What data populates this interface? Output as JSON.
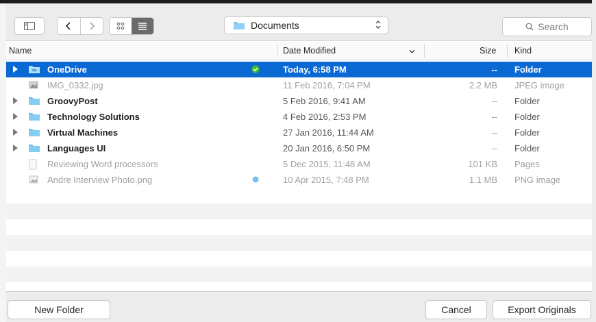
{
  "toolbar": {
    "location": "Documents",
    "search_placeholder": "Search"
  },
  "columns": {
    "name": "Name",
    "date": "Date Modified",
    "size": "Size",
    "kind": "Kind"
  },
  "files": [
    {
      "name": "OneDrive",
      "date": "Today, 6:58 PM",
      "size": "--",
      "kind": "Folder",
      "icon": "folder-cloud-icon",
      "badge": "green-check"
    },
    {
      "name": "IMG_0332.jpg",
      "date": "11 Feb 2016, 7:04 PM",
      "size": "2.2 MB",
      "kind": "JPEG image",
      "icon": "image-file-icon"
    },
    {
      "name": "GroovyPost",
      "date": "5 Feb 2016, 9:41 AM",
      "size": "--",
      "kind": "Folder",
      "icon": "folder-icon"
    },
    {
      "name": "Technology Solutions",
      "date": "4 Feb 2016, 2:53 PM",
      "size": "--",
      "kind": "Folder",
      "icon": "folder-icon"
    },
    {
      "name": "Virtual Machines",
      "date": "27 Jan 2016, 11:44 AM",
      "size": "--",
      "kind": "Folder",
      "icon": "folder-icon"
    },
    {
      "name": "Languages UI",
      "date": "20 Jan 2016, 6:50 PM",
      "size": "--",
      "kind": "Folder",
      "icon": "folder-icon"
    },
    {
      "name": "Reviewing Word processors",
      "date": "5 Dec 2015, 11:48 AM",
      "size": "101 KB",
      "kind": "Pages",
      "icon": "document-icon"
    },
    {
      "name": "Andre Interview Photo.png",
      "date": "10 Apr 2015, 7:48 PM",
      "size": "1.1 MB",
      "kind": "PNG image",
      "icon": "image-file-icon",
      "badge": "blue-dot"
    }
  ],
  "buttons": {
    "new_folder": "New Folder",
    "cancel": "Cancel",
    "export": "Export Originals"
  },
  "colors": {
    "selection": "#0b69d3",
    "folder": "#7cc4ee",
    "check": "#3ec22c",
    "dot": "#7cc0f0"
  }
}
